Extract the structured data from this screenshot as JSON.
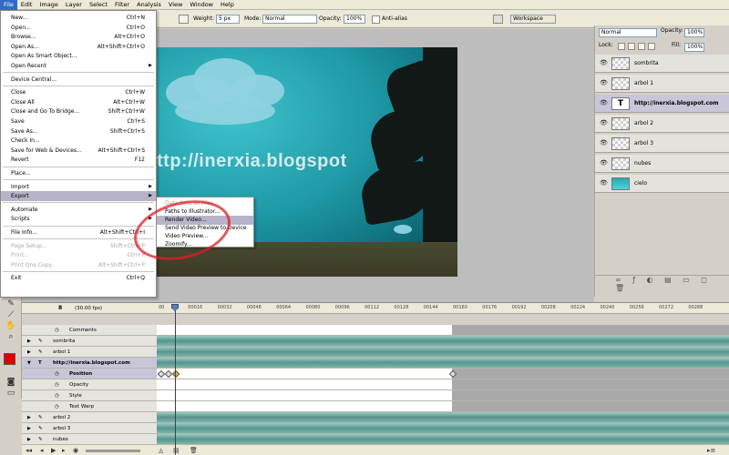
{
  "menubar": [
    "File",
    "Edit",
    "Image",
    "Layer",
    "Select",
    "Filter",
    "Analysis",
    "View",
    "Window",
    "Help"
  ],
  "options": {
    "weight_label": "Weight:",
    "weight_value": "5 px",
    "mode_label": "Mode:",
    "mode_value": "Normal",
    "opacity_label": "Opacity:",
    "opacity_value": "100%",
    "antialias_label": "Anti-alias",
    "workspace_label": "Workspace"
  },
  "canvas_text": "ttp://inerxia.blogspot",
  "file_menu": [
    {
      "label": "New...",
      "shortcut": "Ctrl+N"
    },
    {
      "label": "Open...",
      "shortcut": "Ctrl+O"
    },
    {
      "label": "Browse...",
      "shortcut": "Alt+Ctrl+O"
    },
    {
      "label": "Open As...",
      "shortcut": "Alt+Shift+Ctrl+O"
    },
    {
      "label": "Open As Smart Object...",
      "shortcut": ""
    },
    {
      "label": "Open Recent",
      "shortcut": "",
      "submenu": true
    },
    {
      "label": "Device Central...",
      "shortcut": ""
    },
    {
      "label": "Close",
      "shortcut": "Ctrl+W"
    },
    {
      "label": "Close All",
      "shortcut": "Alt+Ctrl+W"
    },
    {
      "label": "Close and Go To Bridge...",
      "shortcut": "Shift+Ctrl+W"
    },
    {
      "label": "Save",
      "shortcut": "Ctrl+S"
    },
    {
      "label": "Save As...",
      "shortcut": "Shift+Ctrl+S"
    },
    {
      "label": "Check In...",
      "shortcut": ""
    },
    {
      "label": "Save for Web & Devices...",
      "shortcut": "Alt+Shift+Ctrl+S"
    },
    {
      "label": "Revert",
      "shortcut": "F12"
    },
    {
      "label": "Place...",
      "shortcut": ""
    },
    {
      "label": "Import",
      "shortcut": "",
      "submenu": true
    },
    {
      "label": "Export",
      "shortcut": "",
      "submenu": true
    },
    {
      "label": "Automate",
      "shortcut": "",
      "submenu": true
    },
    {
      "label": "Scripts",
      "shortcut": "",
      "submenu": true
    },
    {
      "label": "File Info...",
      "shortcut": "Alt+Shift+Ctrl+I"
    },
    {
      "label": "Page Setup...",
      "shortcut": "Shift+Ctrl+P"
    },
    {
      "label": "Print...",
      "shortcut": "Ctrl+P"
    },
    {
      "label": "Print One Copy",
      "shortcut": "Alt+Shift+Ctrl+P"
    },
    {
      "label": "Exit",
      "shortcut": "Ctrl+Q"
    }
  ],
  "export_menu": [
    "Data Sets as Files...",
    "Paths to Illustrator...",
    "Render Video...",
    "Send Video Preview to Device",
    "Video Preview...",
    "Zoomify..."
  ],
  "layers_panel": {
    "blend_mode": "Normal",
    "opacity_label": "Opacity:",
    "opacity_value": "100%",
    "lock_label": "Lock:",
    "fill_label": "Fill:",
    "fill_value": "100%",
    "layers": [
      {
        "name": "sombrita",
        "thumb": "transparent"
      },
      {
        "name": "arbol 1",
        "thumb": "transparent"
      },
      {
        "name": "http://inerxia.blogspot.com",
        "thumb": "text",
        "selected": true
      },
      {
        "name": "arbol 2",
        "thumb": "transparent"
      },
      {
        "name": "arbol 3",
        "thumb": "transparent"
      },
      {
        "name": "nubes",
        "thumb": "transparent"
      },
      {
        "name": "cielo",
        "thumb": "sky"
      }
    ]
  },
  "timeline": {
    "current_frame": "8",
    "fps": "(30.00 fps)",
    "ticks": [
      "00",
      "00016",
      "00032",
      "00048",
      "00064",
      "00080",
      "00096",
      "00112",
      "00128",
      "00144",
      "00160",
      "00176",
      "00192",
      "00208",
      "00224",
      "00240",
      "00256",
      "00272",
      "00288"
    ],
    "rows": [
      {
        "name": "Comments",
        "type": "sub",
        "indent": 1
      },
      {
        "name": "sombrita",
        "type": "layer",
        "indent": 0
      },
      {
        "name": "arbol 1",
        "type": "layer",
        "indent": 0
      },
      {
        "name": "http://inerxia.blogspot.com",
        "type": "layer",
        "indent": 0,
        "selected": true
      },
      {
        "name": "Position",
        "type": "prop",
        "indent": 1,
        "selected": true
      },
      {
        "name": "Opacity",
        "type": "prop",
        "indent": 1
      },
      {
        "name": "Style",
        "type": "prop",
        "indent": 1
      },
      {
        "name": "Text Warp",
        "type": "prop",
        "indent": 1
      },
      {
        "name": "arbol 2",
        "type": "layer",
        "indent": 0
      },
      {
        "name": "arbol 3",
        "type": "layer",
        "indent": 0
      },
      {
        "name": "nubes",
        "type": "layer",
        "indent": 0
      }
    ]
  },
  "colors": {
    "foreground": "#e00000",
    "background": "#000000"
  }
}
